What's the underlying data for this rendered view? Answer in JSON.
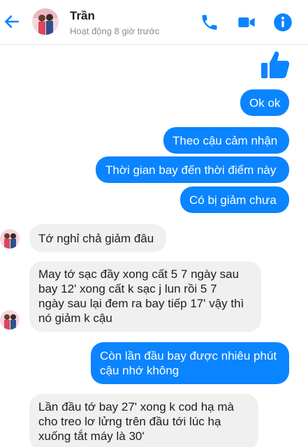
{
  "header": {
    "contact_name": "Trần",
    "status": "Hoạt động 8 giờ trước",
    "accent": "#0a84ff"
  },
  "icons": {
    "back": "arrow-left-icon",
    "call": "phone-icon",
    "video": "video-camera-icon",
    "info": "info-icon",
    "like": "thumbs-up-icon"
  },
  "messages": [
    {
      "from": "me",
      "lines": [
        "Ok ok"
      ]
    },
    {
      "from": "me",
      "lines": [
        "Theo cậu cảm nhận"
      ]
    },
    {
      "from": "me",
      "lines": [
        "Thời gian bay đến thời điểm này"
      ]
    },
    {
      "from": "me",
      "lines": [
        "Có bị giảm chưa"
      ]
    },
    {
      "from": "them",
      "lines": [
        "Tớ nghỉ chả giảm đâu"
      ]
    },
    {
      "from": "them",
      "lines": [
        "May tớ sạc đầy xong cất 5 7 ngày sau",
        "bay 12' xong cất k sạc j lun rồi 5 7",
        "ngày sau lại đem ra bay tiếp 17' vậy thì",
        "nó giảm k cậu"
      ]
    },
    {
      "from": "me",
      "lines": [
        "Còn lần đầu bay được nhiêu phút",
        "cậu nhớ không"
      ]
    },
    {
      "from": "them",
      "lines": [
        "Lần đầu tớ bay 27' xong k cod hạ mà",
        "cho treo lơ lửng trên đầu tới lúc hạ",
        "xuống tắt máy là 30'"
      ]
    }
  ]
}
